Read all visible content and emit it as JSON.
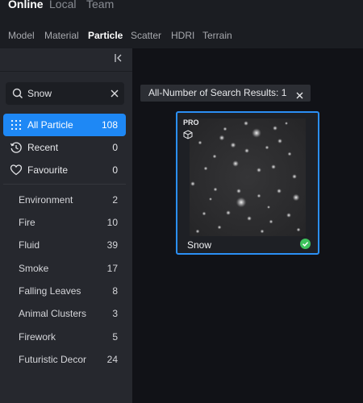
{
  "top_tabs": [
    {
      "label": "Online",
      "active": true
    },
    {
      "label": "Local",
      "active": false
    },
    {
      "label": "Team",
      "active": false
    }
  ],
  "category_tabs": [
    {
      "label": "Model",
      "active": false
    },
    {
      "label": "Material",
      "active": false
    },
    {
      "label": "Particle",
      "active": true
    },
    {
      "label": "Scatter",
      "active": false
    },
    {
      "label": "HDRI",
      "active": false
    },
    {
      "label": "Terrain",
      "active": false
    }
  ],
  "sidebar": {
    "collapse_icon": "collapse-left-icon",
    "search": {
      "value": "Snow",
      "icon": "search-icon",
      "clear_icon": "close-icon"
    },
    "nav": [
      {
        "label": "All Particle",
        "count": "108",
        "icon": "grid-dots-icon",
        "active": true
      },
      {
        "label": "Recent",
        "count": "0",
        "icon": "history-icon",
        "active": false
      },
      {
        "label": "Favourite",
        "count": "0",
        "icon": "heart-icon",
        "active": false
      }
    ],
    "categories": [
      {
        "label": "Environment",
        "count": "2"
      },
      {
        "label": "Fire",
        "count": "10"
      },
      {
        "label": "Fluid",
        "count": "39"
      },
      {
        "label": "Smoke",
        "count": "17"
      },
      {
        "label": "Falling Leaves",
        "count": "8"
      },
      {
        "label": "Animal Clusters",
        "count": "3"
      },
      {
        "label": "Firework",
        "count": "5"
      },
      {
        "label": "Futuristic Decor",
        "count": "24"
      }
    ]
  },
  "main": {
    "result_chip": {
      "label": "All-Number of Search Results: 1",
      "close_icon": "close-icon"
    },
    "card": {
      "badge": "PRO",
      "badge_icon": "cube-icon",
      "title": "Snow",
      "status_icon": "check-circle-icon"
    }
  },
  "colors": {
    "accent": "#1e88f5",
    "card_border": "#2b8ff5",
    "success": "#3ec25c",
    "sidebar_bg": "#26282e",
    "main_bg": "#111217"
  }
}
